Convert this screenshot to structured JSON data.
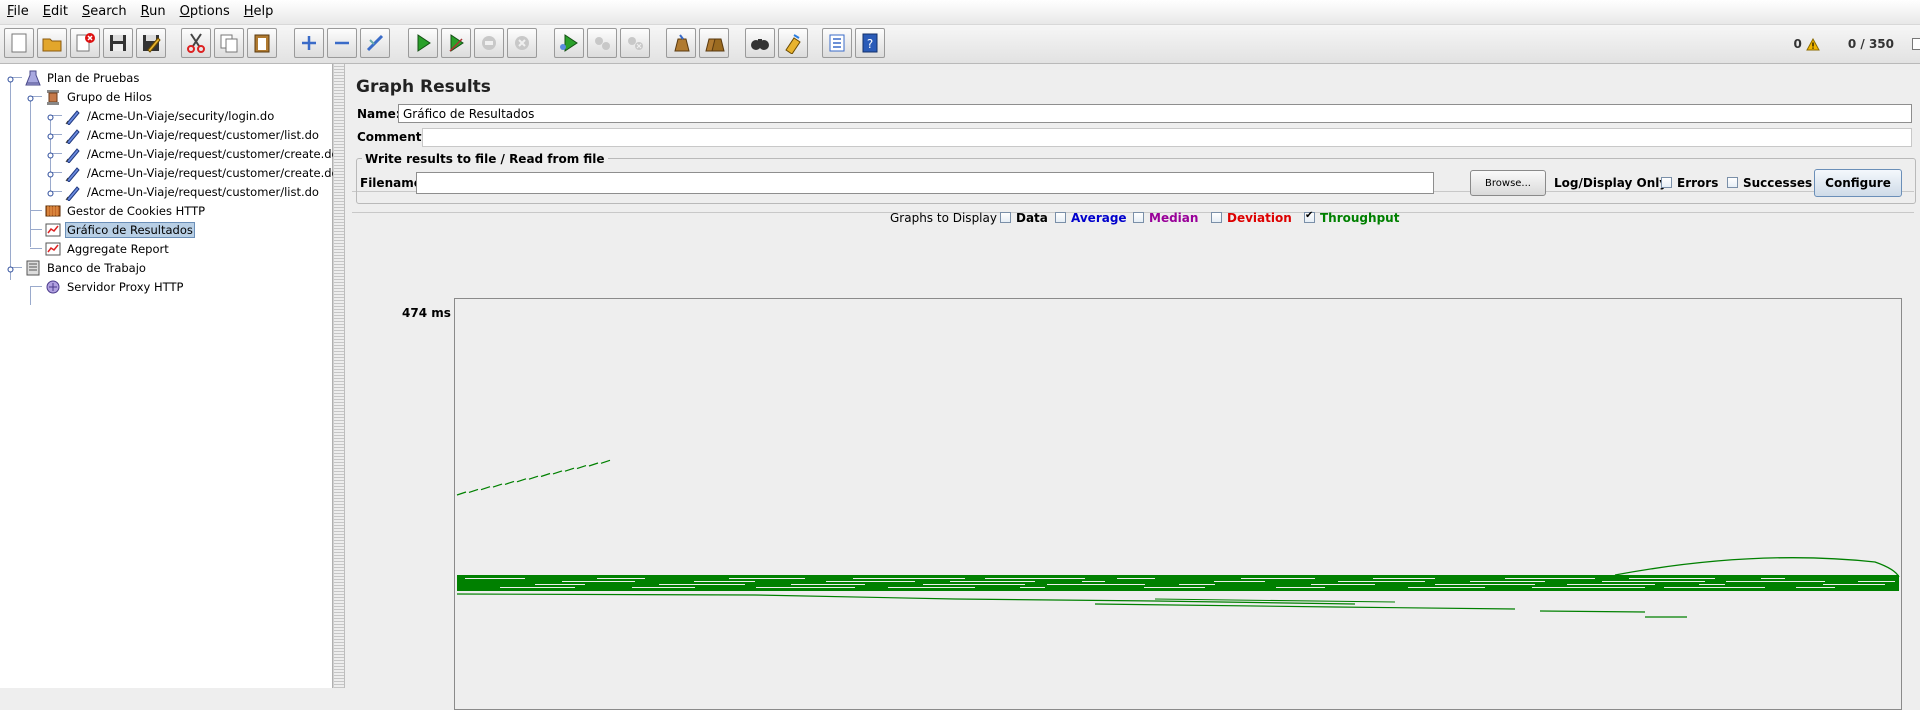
{
  "menu": [
    "File",
    "Edit",
    "Search",
    "Run",
    "Options",
    "Help"
  ],
  "toolbar_icons": [
    "new-icon",
    "open-icon",
    "close-icon",
    "save-icon",
    "save-as-icon",
    "cut-icon",
    "copy-icon",
    "paste-icon",
    "expand-icon",
    "collapse-icon",
    "toggle-icon",
    "start-icon",
    "start-no-pause-icon",
    "stop-icon",
    "shutdown-icon",
    "remote-start-icon",
    "remote-stop-icon",
    "remote-shutdown-icon",
    "clear-icon",
    "clear-all-icon",
    "search-icon",
    "reset-search-icon",
    "function-helper-icon",
    "help-icon"
  ],
  "status": {
    "error_count": "0",
    "threads": "0 / 350"
  },
  "tree": [
    {
      "label": "Plan de Pruebas",
      "icon": "test-plan-icon",
      "level": 0
    },
    {
      "label": "Grupo de Hilos",
      "icon": "thread-group-icon",
      "level": 1
    },
    {
      "label": "/Acme-Un-Viaje/security/login.do",
      "icon": "http-sampler-icon",
      "level": 2
    },
    {
      "label": "/Acme-Un-Viaje/request/customer/list.do",
      "icon": "http-sampler-icon",
      "level": 2
    },
    {
      "label": "/Acme-Un-Viaje/request/customer/create.do",
      "icon": "http-sampler-icon",
      "level": 2
    },
    {
      "label": "/Acme-Un-Viaje/request/customer/create.do",
      "icon": "http-sampler-icon",
      "level": 2
    },
    {
      "label": "/Acme-Un-Viaje/request/customer/list.do",
      "icon": "http-sampler-icon",
      "level": 2
    },
    {
      "label": "Gestor de Cookies HTTP",
      "icon": "cookie-manager-icon",
      "level": 1
    },
    {
      "label": "Gráfico de Resultados",
      "icon": "graph-results-icon",
      "level": 1,
      "selected": true
    },
    {
      "label": "Aggregate Report",
      "icon": "aggregate-report-icon",
      "level": 1
    },
    {
      "label": "Banco de Trabajo",
      "icon": "workbench-icon",
      "level": 0
    },
    {
      "label": "Servidor Proxy HTTP",
      "icon": "proxy-server-icon",
      "level": 1
    }
  ],
  "panel": {
    "title": "Graph Results",
    "name_label": "Name:",
    "name_value": "Gráfico de Resultados",
    "comments_label": "Comments:",
    "file_group_title": "Write results to file / Read from file",
    "filename_label": "Filename",
    "filename_value": "",
    "browse_label": "Browse...",
    "log_display_label": "Log/Display Only:",
    "errors_label": "Errors",
    "successes_label": "Successes",
    "configure_label": "Configure"
  },
  "graphs": {
    "label": "Graphs to Display",
    "options": [
      {
        "label": "Data",
        "checked": false,
        "color": "#000000"
      },
      {
        "label": "Average",
        "checked": false,
        "color": "#0000cc"
      },
      {
        "label": "Median",
        "checked": false,
        "color": "#990099"
      },
      {
        "label": "Deviation",
        "checked": false,
        "color": "#dd0000"
      },
      {
        "label": "Throughput",
        "checked": true,
        "color": "#008000"
      }
    ],
    "y_max_label": "474  ms",
    "throughput_color": "#008000"
  }
}
